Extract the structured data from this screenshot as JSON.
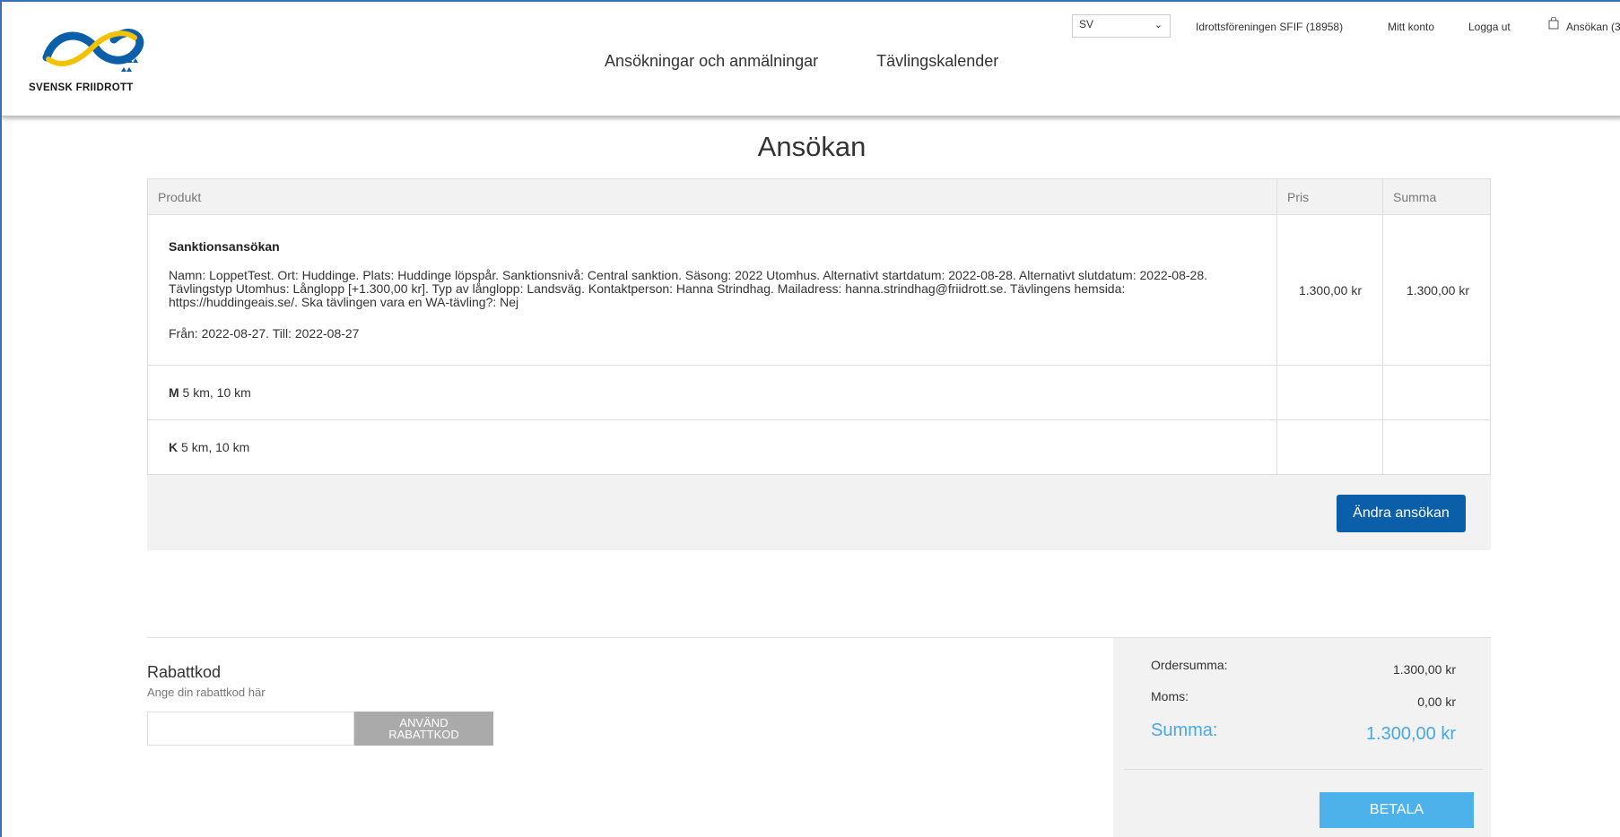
{
  "header": {
    "logo_text": "SVENSK FRIIDROTT",
    "nav": [
      "Ansökningar och anmälningar",
      "Tävlingskalender"
    ],
    "language": "SV",
    "organization": "Idrottsföreningen SFIF (18958)",
    "account": "Mitt konto",
    "logout": "Logga ut",
    "cart": "Ansökan (3"
  },
  "page": {
    "title": "Ansökan"
  },
  "table": {
    "headers": {
      "product": "Produkt",
      "price": "Pris",
      "sum": "Summa"
    },
    "main_row": {
      "name": "Sanktionsansökan",
      "description": "Namn: LoppetTest. Ort: Huddinge. Plats: Huddinge löpspår. Sanktionsnivå: Central sanktion. Säsong: 2022 Utomhus. Alternativt startdatum: 2022-08-28. Alternativt slutdatum: 2022-08-28. Tävlingstyp Utomhus: Långlopp [+1.300,00 kr]. Typ av långlopp: Landsväg. Kontaktperson: Hanna Strindhag. Mailadress: hanna.strindhag@friidrott.se. Tävlingens hemsida: https://huddingeais.se/. Ska tävlingen vara en WA-tävling?: Nej",
      "dates": "Från: 2022-08-27. Till: 2022-08-27",
      "price": "1.300,00 kr",
      "sum": "1.300,00 kr"
    },
    "rows": [
      {
        "class": "M",
        "distances": " 5 km, 10 km"
      },
      {
        "class": "K",
        "distances": " 5 km, 10 km"
      }
    ]
  },
  "edit_button": "Ändra ansökan",
  "discount": {
    "title": "Rabattkod",
    "hint": "Ange din rabattkod här",
    "input_value": "",
    "button_line1": "ANVÄND",
    "button_line2": "RABATTKOD"
  },
  "summary": {
    "order_label": "Ordersumma:",
    "order_value": "1.300,00 kr",
    "vat_label": "Moms:",
    "vat_value": "0,00 kr",
    "total_label": "Summa:",
    "total_value": "1.300,00 kr",
    "pay_button": "BETALA"
  },
  "colors": {
    "brand_blue": "#0b5ea8",
    "pay_blue": "#4db1ea",
    "total_blue": "#4aa8e0",
    "logo_yellow": "#f2c200"
  },
  "icons": {
    "cart": "shopping-bag-icon",
    "language_dropdown": "chevron-down-icon"
  }
}
